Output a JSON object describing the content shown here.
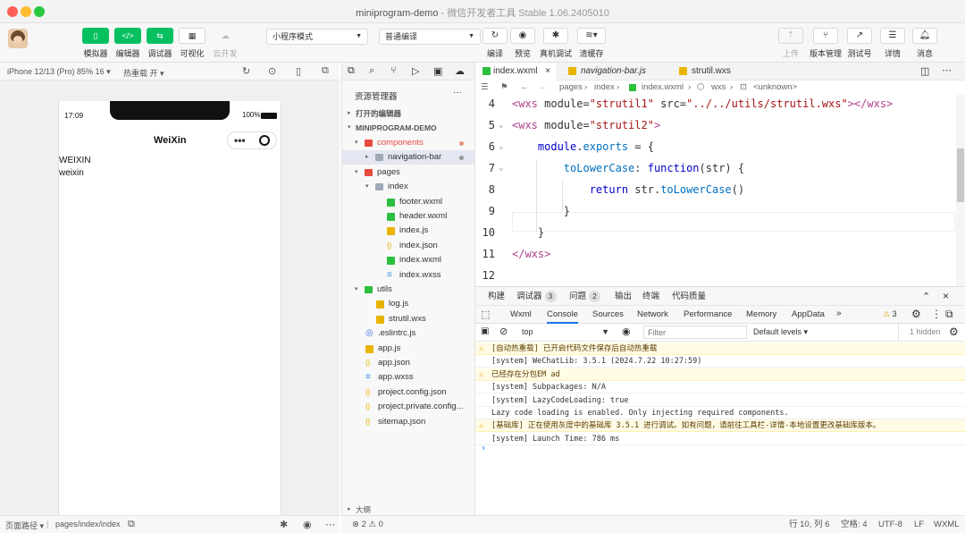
{
  "window": {
    "title": "miniprogram-demo",
    "subtitle": " - 微信开发者工具 Stable 1.06.2405010"
  },
  "toolbar": {
    "simulator": "模拟器",
    "editor": "编辑器",
    "debugger": "调试器",
    "visual": "可视化",
    "cloud": "云开发",
    "mode_select": "小程序模式",
    "compile_select": "普通编译",
    "compile": "编译",
    "preview": "预览",
    "real_debug": "真机调试",
    "clear_cache": "清缓存",
    "upload": "上传",
    "version": "版本管理",
    "test_account": "测试号",
    "details": "详情",
    "messages": "消息"
  },
  "simulator": {
    "device": "iPhone 12/13 (Pro) 85% 16 ▾",
    "hot_reload": "热重载 开 ▾",
    "time": "17:09",
    "battery": "100%",
    "nav_title": "WeiXin",
    "content_line1": "WEIXIN",
    "content_line2": "weixin",
    "page_path_label": "页面路径 ▾",
    "page_path": "pages/index/index"
  },
  "explorer": {
    "title": "资源管理器",
    "more": "···",
    "open_editors": "打开的编辑器",
    "project": "MINIPROGRAM-DEMO",
    "items": [
      {
        "label": "components"
      },
      {
        "label": "navigation-bar"
      },
      {
        "label": "pages"
      },
      {
        "label": "index"
      },
      {
        "label": "footer.wxml"
      },
      {
        "label": "header.wxml"
      },
      {
        "label": "index.js"
      },
      {
        "label": "index.json"
      },
      {
        "label": "index.wxml"
      },
      {
        "label": "index.wxss"
      },
      {
        "label": "utils"
      },
      {
        "label": "log.js"
      },
      {
        "label": "strutil.wxs"
      },
      {
        "label": ".eslintrc.js"
      },
      {
        "label": "app.js"
      },
      {
        "label": "app.json"
      },
      {
        "label": "app.wxss"
      },
      {
        "label": "project.config.json"
      },
      {
        "label": "project.private.config..."
      },
      {
        "label": "sitemap.json"
      }
    ],
    "outline": "大纲",
    "problems": "⊗ 2 ⚠ 0"
  },
  "editor": {
    "tabs": [
      {
        "label": "index.wxml"
      },
      {
        "label": "navigation-bar.js"
      },
      {
        "label": "strutil.wxs"
      }
    ],
    "breadcrumb": [
      "pages",
      "index",
      "index.wxml",
      "wxs",
      "<unknown>"
    ],
    "lines": [
      {
        "num": "4",
        "tokens": [
          [
            "tag",
            "<wxs"
          ],
          [
            "attr",
            " module="
          ],
          [
            "str",
            "\"strutil1\""
          ],
          [
            "attr",
            " src="
          ],
          [
            "str",
            "\"../../utils/strutil.wxs\""
          ],
          [
            "tag",
            "></wxs>"
          ]
        ]
      },
      {
        "num": "5",
        "tokens": [
          [
            "tag",
            "<wxs"
          ],
          [
            "attr",
            " module="
          ],
          [
            "str",
            "\"strutil2\""
          ],
          [
            "tag",
            ">"
          ]
        ]
      },
      {
        "num": "6",
        "tokens": [
          [
            "pl",
            "    "
          ],
          [
            "kw",
            "module"
          ],
          [
            "pl",
            "."
          ],
          [
            "fn",
            "exports"
          ],
          [
            "pl",
            " = {"
          ]
        ]
      },
      {
        "num": "7",
        "tokens": [
          [
            "pl",
            "        "
          ],
          [
            "fn",
            "toLowerCase"
          ],
          [
            "pl",
            ": "
          ],
          [
            "kw",
            "function"
          ],
          [
            "pl",
            "(str) {"
          ]
        ]
      },
      {
        "num": "8",
        "tokens": [
          [
            "pl",
            "            "
          ],
          [
            "kw",
            "return"
          ],
          [
            "pl",
            " str."
          ],
          [
            "fn",
            "toLowerCase"
          ],
          [
            "pl",
            "()"
          ]
        ]
      },
      {
        "num": "9",
        "tokens": [
          [
            "pl",
            "        }"
          ]
        ]
      },
      {
        "num": "10",
        "tokens": [
          [
            "pl",
            "    }"
          ]
        ]
      },
      {
        "num": "11",
        "tokens": [
          [
            "tag",
            "</wxs>"
          ]
        ]
      },
      {
        "num": "12",
        "tokens": []
      }
    ]
  },
  "devtools": {
    "tabs": [
      {
        "label": "构建"
      },
      {
        "label": "调试器",
        "badge": "3"
      },
      {
        "label": "问题",
        "badge": "2"
      },
      {
        "label": "输出"
      },
      {
        "label": "终端"
      },
      {
        "label": "代码质量"
      }
    ],
    "panels": [
      "Wxml",
      "Console",
      "Sources",
      "Network",
      "Performance",
      "Memory",
      "AppData"
    ],
    "warn_count": "3",
    "context": "top",
    "filter_placeholder": "Filter",
    "levels": "Default levels ▾",
    "hidden": "1 hidden",
    "console": [
      {
        "type": "warn",
        "text": "[自动热重载] 已开启代码文件保存后自动热重载"
      },
      {
        "type": "log",
        "text": "[system] WeChatLib: 3.5.1 (2024.7.22 10:27:59)"
      },
      {
        "type": "warn",
        "text": "已经存在分包EM ad"
      },
      {
        "type": "log",
        "text": "[system] Subpackages: N/A"
      },
      {
        "type": "log",
        "text": "[system] LazyCodeLoading: true"
      },
      {
        "type": "log",
        "text": "Lazy code loading is enabled. Only injecting required components."
      },
      {
        "type": "warn",
        "text": "[基础库] 正在使用灰度中的基础库 3.5.1 进行调试。如有问题，请前往工具栏-详情-本地设置更改基础库版本。"
      },
      {
        "type": "log",
        "text": "[system] Launch Time: 786 ms"
      }
    ]
  },
  "statusbar": {
    "position": "行 10, 列 6",
    "spaces": "空格: 4",
    "encoding": "UTF-8",
    "eol": "LF",
    "lang": "WXML"
  }
}
